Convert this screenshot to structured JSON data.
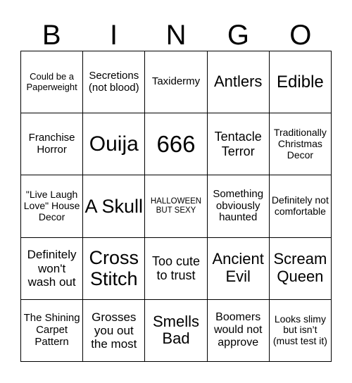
{
  "header": {
    "letters": [
      "B",
      "I",
      "N",
      "G",
      "O"
    ]
  },
  "cells": [
    "Could be a Paperweight",
    "Secretions (not blood)",
    "Taxidermy",
    "Antlers",
    "Edible",
    "Franchise Horror",
    "Ouija",
    "666",
    "Tentacle Terror",
    "Traditionally Christmas Decor",
    "\"Live Laugh Love\" House Decor",
    "A Skull",
    "HALLOWEEN BUT SEXY",
    "Something obviously haunted",
    "Definitely not comfortable",
    "Definitely won't wash out",
    "Cross Stitch",
    "Too cute to trust",
    "Ancient Evil",
    "Scream Queen",
    "The Shining Carpet Pattern",
    "Grosses you out the most",
    "Smells Bad",
    "Boomers would not approve",
    "Looks slimy but isn’t (must test it)"
  ]
}
